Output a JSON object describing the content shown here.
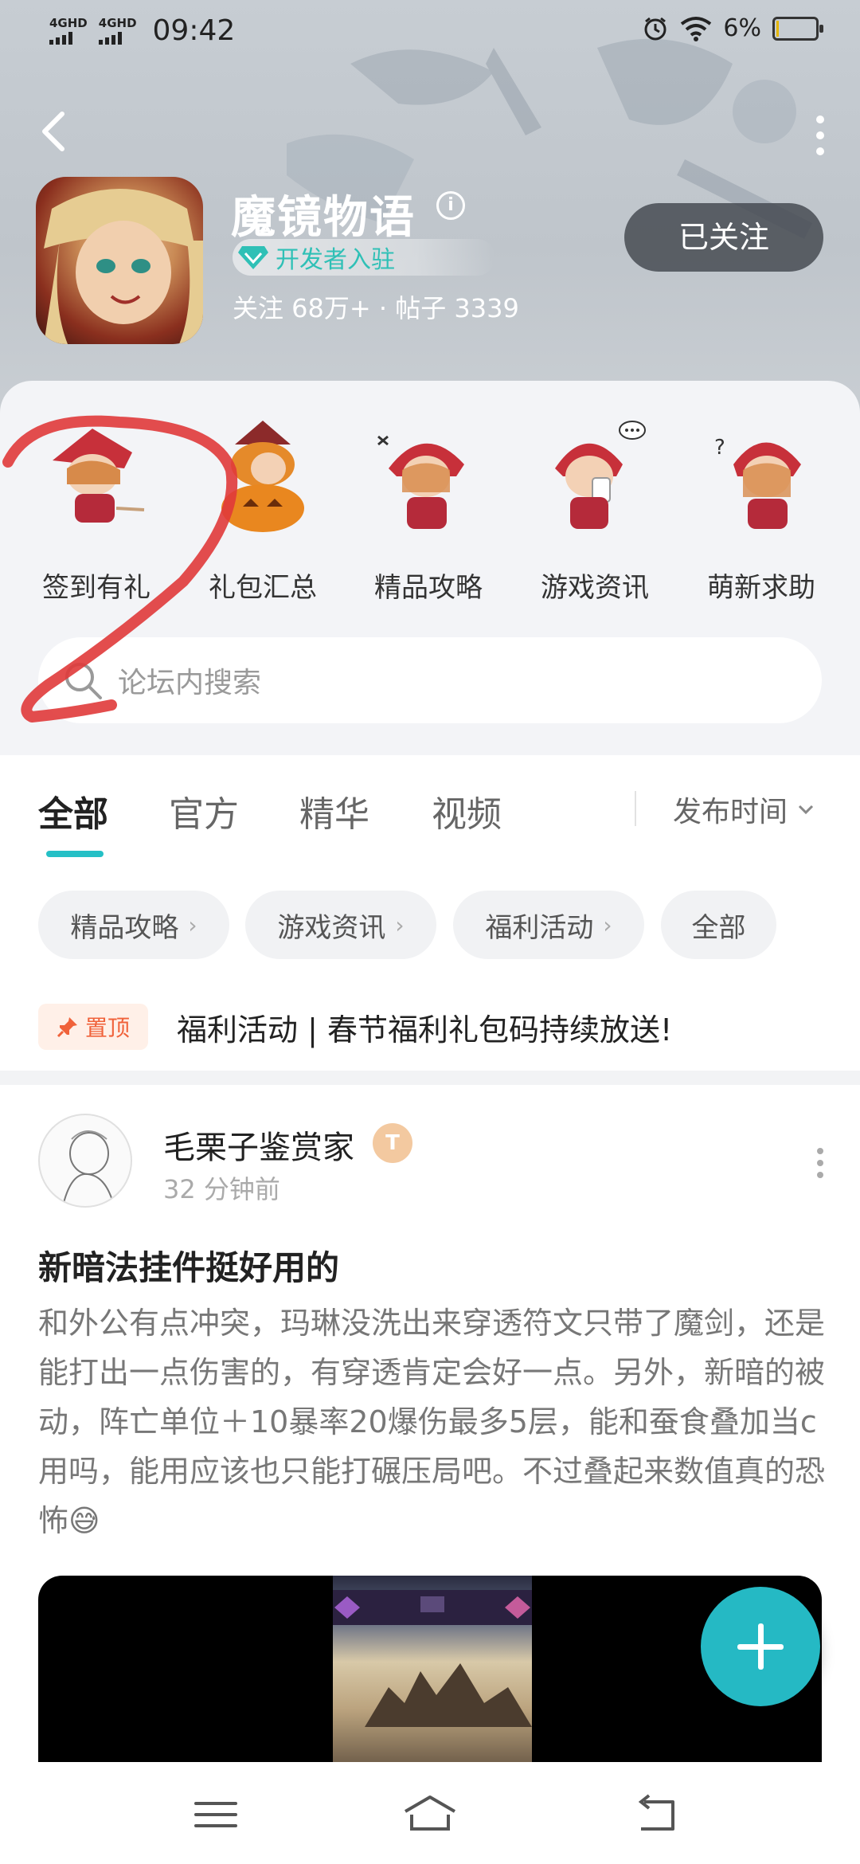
{
  "status_bar": {
    "signal_1": "4GHD",
    "signal_2": "4GHD",
    "time": "09:42",
    "battery_percent": "6%",
    "battery_level": 0.06,
    "icons": [
      "alarm-icon",
      "wifi-icon",
      "battery-icon"
    ]
  },
  "header": {
    "title": "魔镜物语",
    "developer_badge": "开发者入驻",
    "stats": "关注 68万+ · 帖子 3339",
    "follow_button": "已关注",
    "icons": [
      "back-icon",
      "more-vertical-icon",
      "info-icon",
      "diamond-icon"
    ]
  },
  "quick_actions": [
    {
      "label": "签到有礼",
      "icon": "checkin-character-icon"
    },
    {
      "label": "礼包汇总",
      "icon": "pumpkin-character-icon"
    },
    {
      "label": "精品攻略",
      "icon": "guide-character-icon"
    },
    {
      "label": "游戏资讯",
      "icon": "news-character-icon"
    },
    {
      "label": "萌新求助",
      "icon": "help-character-icon"
    }
  ],
  "search": {
    "placeholder": "论坛内搜索"
  },
  "tabs": [
    {
      "label": "全部",
      "active": true
    },
    {
      "label": "官方",
      "active": false
    },
    {
      "label": "精华",
      "active": false
    },
    {
      "label": "视频",
      "active": false
    }
  ],
  "sort": {
    "label": "发布时间"
  },
  "chips": [
    {
      "label": "精品攻略",
      "arrow": "›"
    },
    {
      "label": "游戏资讯",
      "arrow": "›"
    },
    {
      "label": "福利活动",
      "arrow": "›"
    },
    {
      "label": "全部",
      "arrow": ""
    }
  ],
  "pinned": {
    "badge": "置顶",
    "text": "福利活动 | 春节福利礼包码持续放送!"
  },
  "post": {
    "username": "毛栗子鉴赏家",
    "level_badge": "T",
    "time": "32 分钟前",
    "title": "新暗法挂件挺好用的",
    "body": "和外公有点冲突，玛琳没洗出来穿透符文只带了魔剑，还是能打出一点伤害的，有穿透肯定会好一点。另外，新暗的被动，阵亡单位＋10暴率20爆伤最多5层，能和蚕食叠加当c用吗，能用应该也只能打碾压局吧。不过叠起来数值真的恐怖😅"
  },
  "colors": {
    "accent": "#25c0c6",
    "pinned": "#f0623a",
    "annotation": "#e03a3a"
  }
}
